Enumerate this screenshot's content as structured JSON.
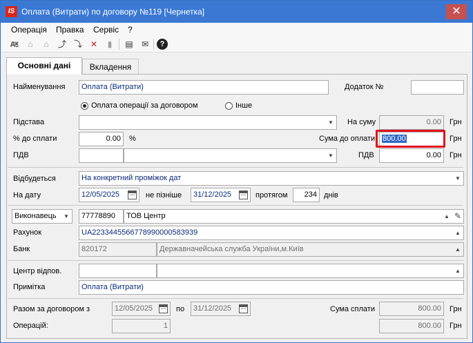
{
  "window": {
    "app_icon_text": "IS",
    "title": "Оплата (Витрати) по договору №119 [Чернетка]",
    "close_glyph": "✕"
  },
  "menu": [
    "Операція",
    "Правка",
    "Сервіс",
    "?"
  ],
  "toolbar_icons": [
    {
      "name": "dk-icon",
      "glyph": "дк",
      "disabled": false
    },
    {
      "name": "bank-up-icon",
      "glyph": "⌂",
      "disabled": true
    },
    {
      "name": "bank-down-icon",
      "glyph": "⌂",
      "disabled": true
    },
    {
      "name": "import-icon",
      "glyph": "⤴",
      "disabled": false
    },
    {
      "name": "export-icon",
      "glyph": "⤵",
      "disabled": false
    },
    {
      "name": "delete-icon",
      "glyph": "✕",
      "disabled": false
    },
    {
      "name": "stamp-icon",
      "glyph": "▮",
      "disabled": true
    },
    {
      "name": "document-icon",
      "glyph": "▤",
      "disabled": false
    },
    {
      "name": "mail-icon",
      "glyph": "✉",
      "disabled": false
    },
    {
      "name": "help-icon",
      "glyph": "?",
      "disabled": false
    }
  ],
  "tabs": {
    "main": "Основні дані",
    "attachments": "Вкладення"
  },
  "form": {
    "name_label": "Найменування",
    "name_value": "Оплата (Витрати)",
    "appendix_label": "Додаток №",
    "appendix_value": "",
    "radio_contract": "Оплата операції за договором",
    "radio_other": "Інше",
    "basis_label": "Підстава",
    "basis_value": "",
    "amount_label": "На суму",
    "amount_value": "0.00",
    "currency": "Грн",
    "pct_label": "% до сплати",
    "pct_value": "0.00",
    "pct_unit": "%",
    "pay_amount_label": "Сума до оплати",
    "pay_amount_value": "800.00",
    "vat_label": "ПДВ",
    "vat_left_value": "",
    "vat_right_label": "ПДВ",
    "vat_right_value": "0.00",
    "happens_label": "Відбудеться",
    "happens_value": "На конкретний проміжок дат",
    "date_label": "На дату",
    "date_value": "12/05/2025",
    "not_later_label": "не пізніше",
    "not_later_value": "31/12/2025",
    "during_label": "протягом",
    "during_value": "234",
    "days_label": "днів",
    "executor_select": "Виконавець",
    "executor_code": "77778890",
    "executor_name": "ТОВ Центр",
    "account_label": "Рахунок",
    "account_value": "UA223344556677899000058393​9",
    "bank_label": "Банк",
    "bank_code": "820172",
    "bank_name": "Державначейська служба України,м.Київ",
    "center_label": "Центр відпов.",
    "center_value": "",
    "note_label": "Примітка",
    "note_value": "Оплата (Витрати)",
    "total_label": "Разом за договором з",
    "total_from": "12/05/2025",
    "total_to_label": "по",
    "total_to": "31/12/2025",
    "sum_paid_label": "Сума сплати",
    "sum_paid_value": "800.00",
    "operations_label": "Операцій:",
    "operations_value": "1",
    "operations_amount": "800.00"
  }
}
